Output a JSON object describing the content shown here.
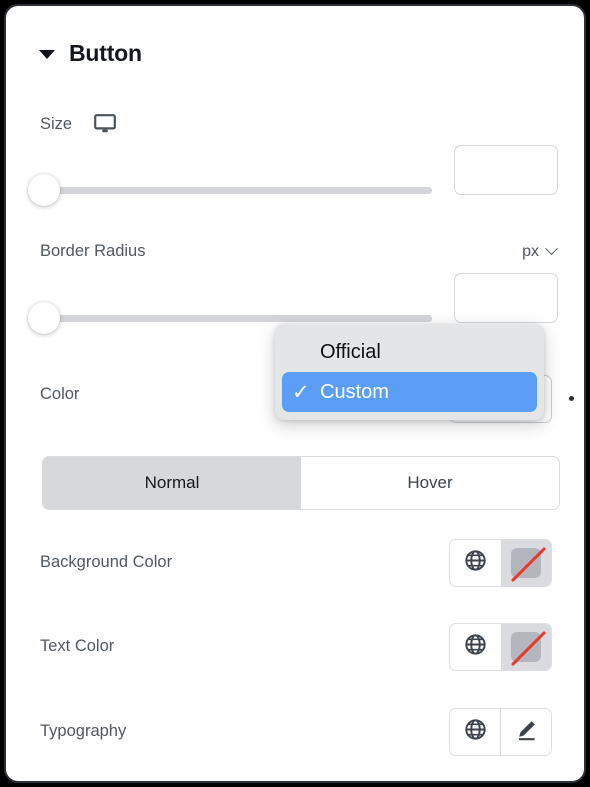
{
  "panel": {
    "title": "Button",
    "collapse_icon": "caret-down-icon"
  },
  "size": {
    "label": "Size",
    "device_icon": "monitor-icon",
    "slider_value_percent": 0,
    "input_value": "",
    "input_placeholder": ""
  },
  "border_radius": {
    "label": "Border Radius",
    "unit": "px",
    "unit_chevron_icon": "chevron-down-icon",
    "slider_value_percent": 0,
    "input_value": "",
    "input_placeholder": ""
  },
  "color": {
    "label": "Color"
  },
  "dropdown": {
    "options": [
      {
        "label": "Official",
        "selected": false,
        "check_icon": ""
      },
      {
        "label": "Custom",
        "selected": true,
        "check_icon": "✓"
      }
    ],
    "highlight_color": "#5a9ef8",
    "background_color": "#e4e5e6"
  },
  "state_tabs": {
    "items": [
      {
        "label": "Normal",
        "active": true
      },
      {
        "label": "Hover",
        "active": false
      }
    ],
    "active_background": "#d6d8da"
  },
  "rows": [
    {
      "label": "Background Color",
      "globe_icon": "globe-icon",
      "second_icon": "no-color-swatch-icon",
      "swatch_color": "#b3b7bd",
      "strike_color": "#e8392c"
    },
    {
      "label": "Text Color",
      "globe_icon": "globe-icon",
      "second_icon": "no-color-swatch-icon",
      "swatch_color": "#b3b7bd",
      "strike_color": "#e8392c"
    },
    {
      "label": "Typography",
      "globe_icon": "globe-icon",
      "second_icon": "pencil-edit-icon"
    }
  ]
}
